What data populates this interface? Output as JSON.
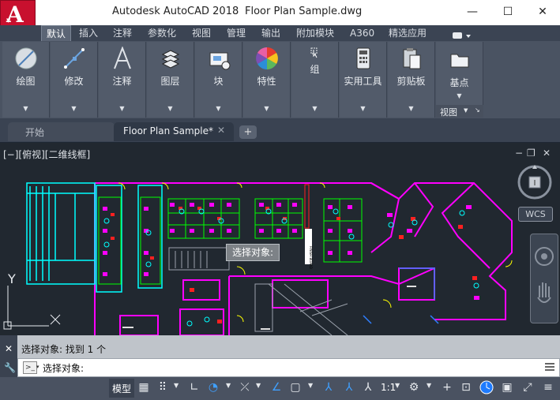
{
  "window": {
    "app_title": "Autodesk AutoCAD 2018",
    "file_title": "Floor Plan Sample.dwg",
    "minimize": "—",
    "maximize": "☐",
    "close": "✕"
  },
  "app_logo": {
    "letter": "A",
    "icon": "autocad-logo-icon"
  },
  "ribbon_tabs": [
    "默认",
    "插入",
    "注释",
    "参数化",
    "视图",
    "管理",
    "输出",
    "附加模块",
    "A360",
    "精选应用"
  ],
  "ribbon_panels": [
    {
      "label": "绘图",
      "icon": "draw-icon"
    },
    {
      "label": "修改",
      "icon": "modify-icon"
    },
    {
      "label": "注释",
      "icon": "annotation-icon"
    },
    {
      "label": "图层",
      "icon": "layers-icon"
    },
    {
      "label": "块",
      "icon": "block-icon"
    },
    {
      "label": "特性",
      "icon": "properties-icon"
    },
    {
      "label": "组",
      "icon": "group-icon"
    },
    {
      "label": "实用工具",
      "icon": "utilities-icon"
    },
    {
      "label": "剪贴板",
      "icon": "clipboard-icon"
    },
    {
      "label": "基点",
      "icon": "base-point-icon"
    }
  ],
  "view_panel_label": "视图",
  "doc_tabs": {
    "start": "开始",
    "file": "Floor Plan Sample*",
    "close": "✕",
    "new": "+"
  },
  "viewport": {
    "label": "[−][俯视][二维线框]",
    "min": "−",
    "restore": "❐",
    "close": "✕",
    "wcs": "WCS",
    "y_axis": "Y",
    "tooltip": "选择对象:",
    "rotated_text": "FINISH BOARD"
  },
  "command": {
    "history": "选择对象: 找到 1 个",
    "prompt": "选择对象:"
  },
  "statusbar": {
    "model": "模型",
    "scale": "1:1"
  },
  "colors": {
    "viewport_bg": "#212830",
    "accent_cyan": "#00ffff",
    "accent_magenta": "#ff00ff",
    "accent_green": "#00ff00",
    "accent_red": "#ff0000",
    "accent_yellow": "#ffff00",
    "accent_blue": "#1e7bff"
  }
}
